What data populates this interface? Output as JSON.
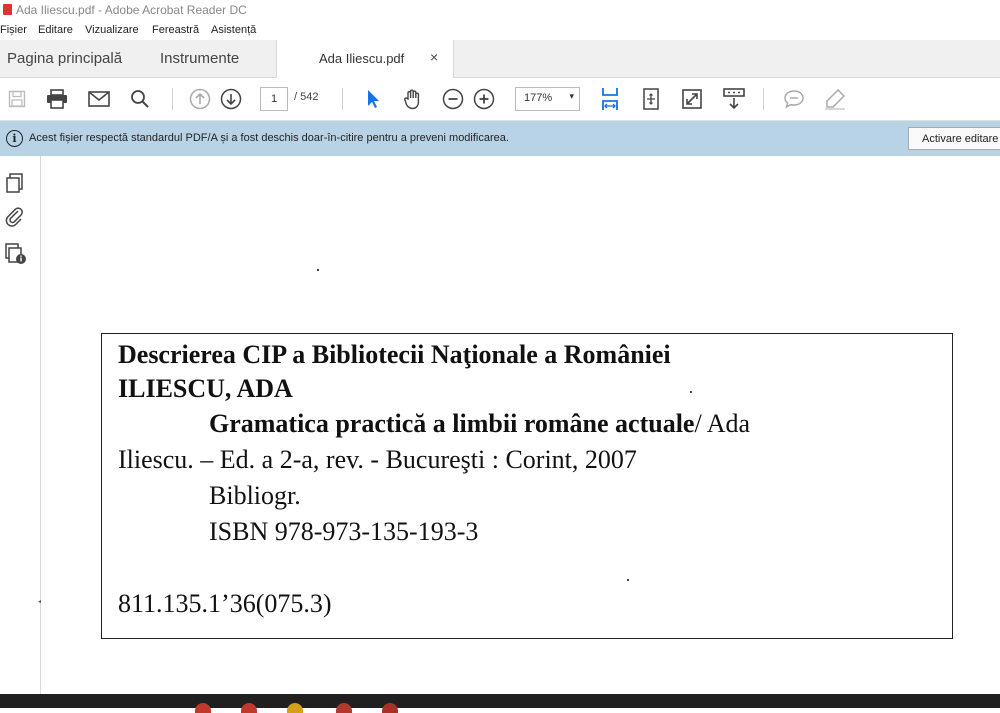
{
  "window": {
    "title": "Ada Iliescu.pdf - Adobe Acrobat Reader DC"
  },
  "menu": [
    "Fișier",
    "Editare",
    "Vizualizare",
    "Fereastră",
    "Asistență"
  ],
  "tabs": {
    "home": "Pagina principală",
    "tools": "Instrumente",
    "document": "Ada Iliescu.pdf",
    "close": "×"
  },
  "toolbar": {
    "page_current": "1",
    "page_total": "/ 542",
    "zoom": "177%",
    "zoom_caret": "▾"
  },
  "infobar": {
    "icon": "i",
    "message": "Acest fișier respectă standardul PDF/A și a fost deschis doar-în-citire pentru a preveni modificarea.",
    "button": "Activare editare"
  },
  "left_panel": {
    "collapse_arrow": "◀"
  },
  "document": {
    "cip_heading": "Descrierea CIP a Bibliotecii Naţionale a României",
    "author_heading": "ILIESCU, ADA",
    "book_title": "Gramatica practică a limbii române actuale",
    "author_suffix": "/  Ada",
    "edition_line": "Iliescu. – Ed. a 2-a, rev. - Bucureşti : Corint, 2007",
    "bibliography": "Bibliogr.",
    "isbn": "ISBN 978-973-135-193-3",
    "classification": "811.135.1’36(075.3)"
  },
  "colors": {
    "infobar": "#b9d3e6",
    "accent_blue": "#1473e6",
    "taskbar": "#202020"
  }
}
